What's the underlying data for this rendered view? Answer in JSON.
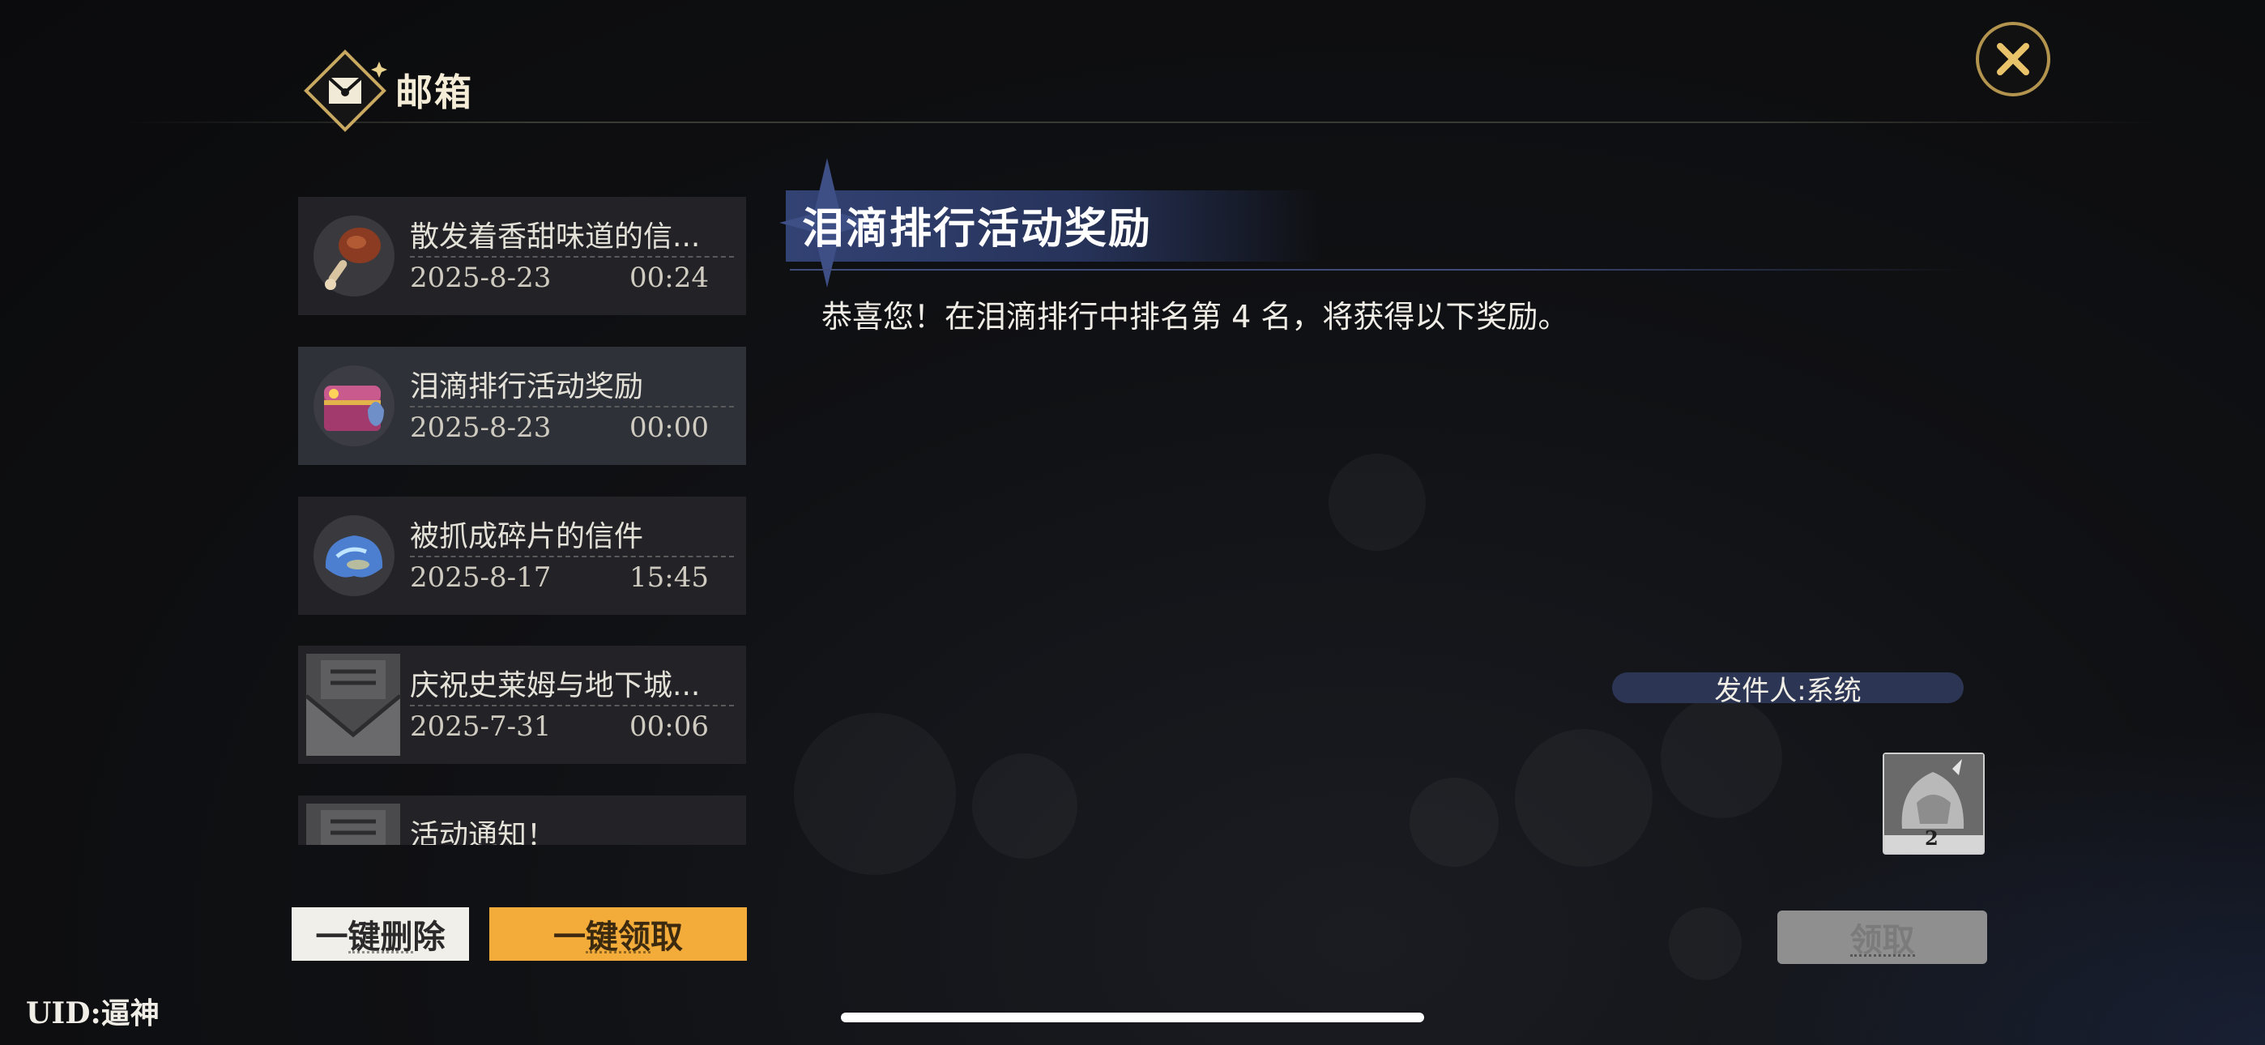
{
  "header": {
    "title": "邮箱"
  },
  "mail_list": [
    {
      "subject": "散发着香甜味道的信...",
      "date": "2025-8-23",
      "time": "00:24",
      "icon": "roast-drumstick-icon"
    },
    {
      "subject": "泪滴排行活动奖励",
      "date": "2025-8-23",
      "time": "00:00",
      "icon": "treasure-chest-icon",
      "selected": true
    },
    {
      "subject": "被抓成碎片的信件",
      "date": "2025-8-17",
      "time": "15:45",
      "icon": "crystal-slime-icon"
    },
    {
      "subject": "庆祝史莱姆与地下城...",
      "date": "2025-7-31",
      "time": "00:06",
      "icon": "envelope-icon"
    },
    {
      "subject": "活动通知！",
      "date": "",
      "time": "",
      "icon": "envelope-icon"
    }
  ],
  "actions": {
    "delete_all": "一键删除",
    "claim_all": "一键领取",
    "claim": "领取"
  },
  "detail": {
    "title": "泪滴排行活动奖励",
    "body": "恭喜您！在泪滴排行中排名第 4 名，将获得以下奖励。",
    "sender": "发件人:系统",
    "reward": {
      "icon": "dragon-armor-icon",
      "count": "2"
    }
  },
  "uid": "UID:逼神",
  "colors": {
    "accent_gold": "#b3944f",
    "claim_orange": "#f3ac3a",
    "title_banner": "#324273",
    "selected_item": "#2f3138"
  }
}
